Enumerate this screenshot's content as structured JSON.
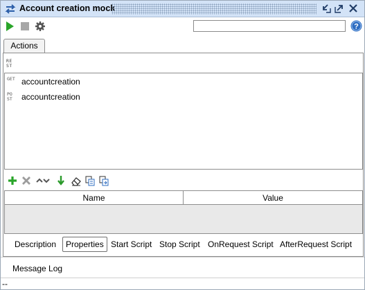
{
  "window": {
    "title": "Account creation mock"
  },
  "toolbar": {
    "search_value": "",
    "icons": [
      "run-icon",
      "stop-icon",
      "settings-icon",
      "help-icon"
    ]
  },
  "tabs": {
    "active": "Actions"
  },
  "rest_badge": "RE ST",
  "actions": [
    {
      "method_icon": "GET",
      "label": "accountcreation"
    },
    {
      "method_icon": "PO ST",
      "label": "accountcreation"
    }
  ],
  "props_toolbar_icons": [
    "add-icon",
    "delete-icon",
    "move-up-icon",
    "move-down-icon",
    "import-icon",
    "clear-icon",
    "copy-icon",
    "paste-icon"
  ],
  "properties_table": {
    "columns": [
      "Name",
      "Value"
    ],
    "rows": []
  },
  "bottom_tabs": [
    "Description",
    "Properties",
    "Start Script",
    "Stop Script",
    "OnRequest Script",
    "AfterRequest Script"
  ],
  "bottom_tab_selected": "Properties",
  "message_log": "Message Log",
  "status": "--",
  "colors": {
    "titlebar": "#d3e3f7",
    "run_green": "#2aa52a",
    "help_blue": "#2d6cc1"
  }
}
